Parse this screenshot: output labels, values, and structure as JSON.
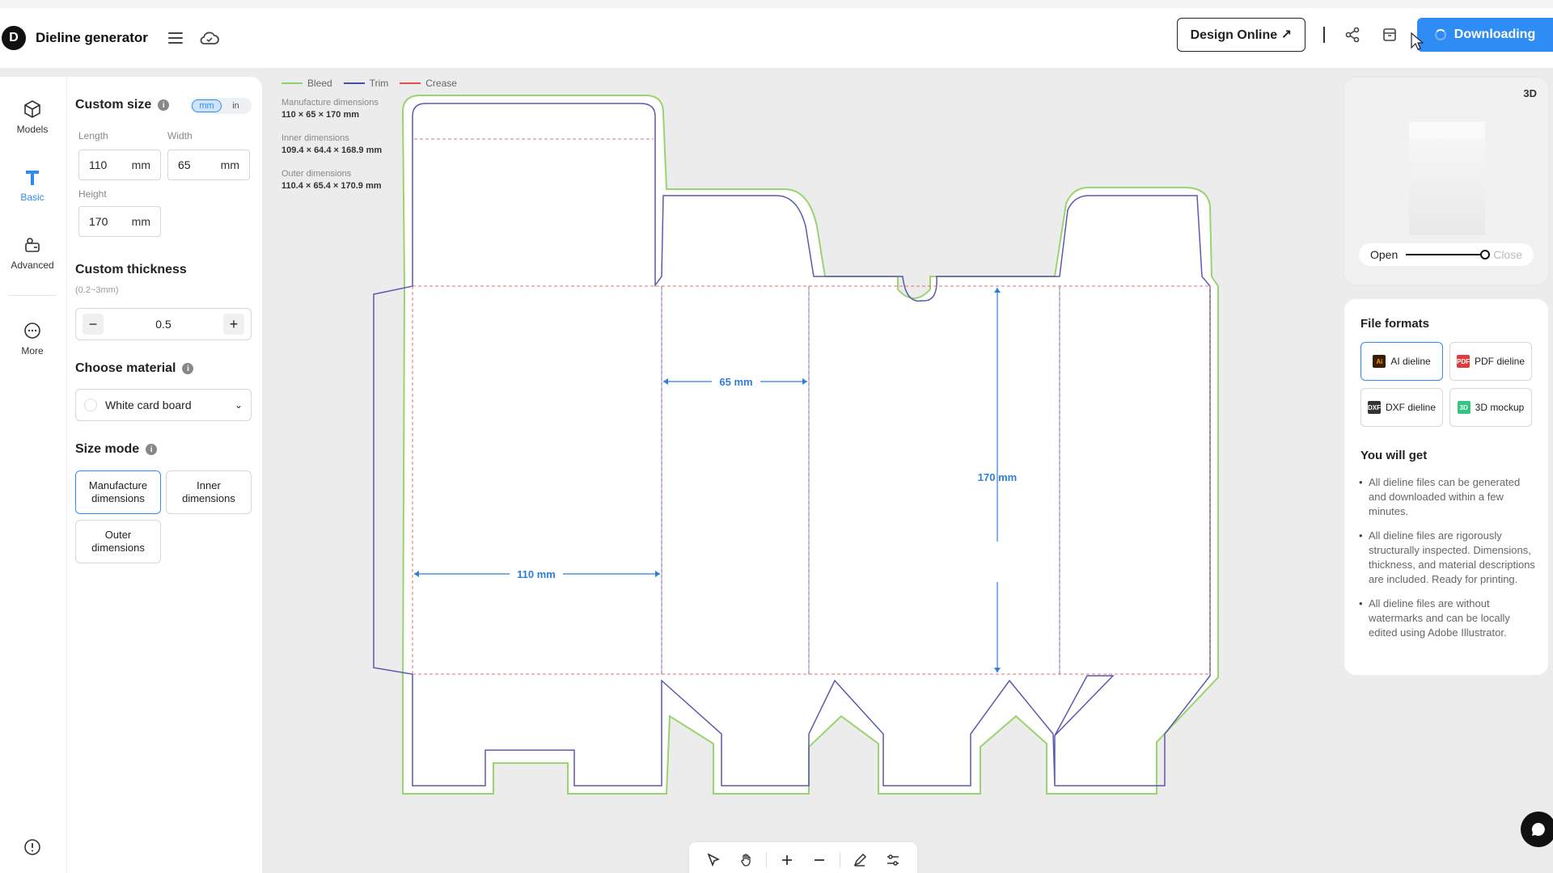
{
  "header": {
    "app_title": "Dieline generator",
    "design_online_label": "Design Online ↗",
    "download_label": "Downloading"
  },
  "rail": {
    "items": [
      {
        "label": "Models",
        "icon": "cube-icon"
      },
      {
        "label": "Basic",
        "icon": "text-icon"
      },
      {
        "label": "Advanced",
        "icon": "advanced-icon"
      },
      {
        "label": "More",
        "icon": "more-icon"
      }
    ]
  },
  "size": {
    "title": "Custom size",
    "units": [
      "mm",
      "in"
    ],
    "length_label": "Length",
    "width_label": "Width",
    "height_label": "Height",
    "length": "110",
    "width": "65",
    "height": "170",
    "unit": "mm"
  },
  "thickness": {
    "title": "Custom thickness",
    "hint": "(0.2~3mm)",
    "value": "0.5",
    "minus": "−",
    "plus": "+"
  },
  "material": {
    "title": "Choose material",
    "value": "White card board"
  },
  "size_mode": {
    "title": "Size mode",
    "options": [
      "Manufacture dimensions",
      "Inner dimensions",
      "Outer dimensions"
    ]
  },
  "canvas": {
    "legend": [
      {
        "label": "Bleed",
        "color": "#8fd16a"
      },
      {
        "label": "Trim",
        "color": "#4b4ba0"
      },
      {
        "label": "Crease",
        "color": "#e05050"
      }
    ],
    "dimensions": [
      {
        "label": "Manufacture dimensions",
        "value": "110 × 65 × 170 mm"
      },
      {
        "label": "Inner dimensions",
        "value": "109.4 × 64.4 × 168.9 mm"
      },
      {
        "label": "Outer dimensions",
        "value": "110.4 × 65.4 × 170.9 mm"
      }
    ],
    "annotations": {
      "w65": "65 mm",
      "h170": "170 mm",
      "l110": "110 mm"
    }
  },
  "preview": {
    "badge": "3D",
    "open_label": "Open",
    "close_label": "Close"
  },
  "formats": {
    "title": "File formats",
    "items": [
      {
        "label": "AI dieline",
        "badge": "Ai",
        "color": "#3a1d00"
      },
      {
        "label": "PDF dieline",
        "badge": "PDF",
        "color": "#e03c3c"
      },
      {
        "label": "DXF dieline",
        "badge": "DXF",
        "color": "#333333"
      },
      {
        "label": "3D mockup",
        "badge": "3D",
        "color": "#36c486"
      }
    ],
    "you_will_get_title": "You will get",
    "bullets": [
      "All dieline files can be generated and downloaded within a few minutes.",
      "All dieline files are rigorously structurally inspected. Dimensions, thickness, and material descriptions are included. Ready for printing.",
      "All dieline files are without watermarks and can be locally edited using Adobe Illustrator."
    ]
  }
}
